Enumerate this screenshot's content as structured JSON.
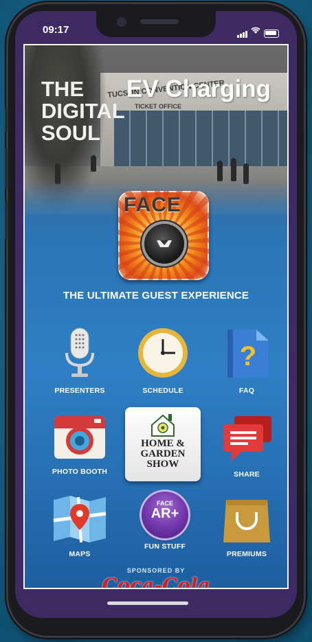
{
  "status": {
    "time": "09:17"
  },
  "hero": {
    "title_left_lines": [
      "THE",
      "DIGITAL",
      "SOUL"
    ],
    "title_right": "EV Charging",
    "building_sign": "TUCSON CONVENTION CENTER",
    "building_subsign": "TICKET OFFICE"
  },
  "logo": {
    "text": "FACE"
  },
  "tagline": "THE ULTIMATE GUEST EXPERIENCE",
  "grid": {
    "presenters": "PRESENTERS",
    "schedule": "SCHEDULE",
    "faq": "FAQ",
    "photo_booth": "PHOTO BOOTH",
    "share": "SHARE",
    "maps": "MAPS",
    "fun_stuff": "FUN STUFF",
    "premiums": "PREMIUMS"
  },
  "center_card": {
    "lines": [
      "HOME &",
      "GARDEN",
      "SHOW"
    ]
  },
  "ar_badge": {
    "small": "FACE",
    "big": "AR+"
  },
  "sponsor": {
    "label": "SPONSORED BY",
    "brand": "Coca-Cola"
  },
  "colors": {
    "app_blue": "#2f7fc4",
    "screen_purple": "#3d2a63",
    "coke_red": "#d81e1e",
    "accent_orange": "#f28b1c"
  }
}
